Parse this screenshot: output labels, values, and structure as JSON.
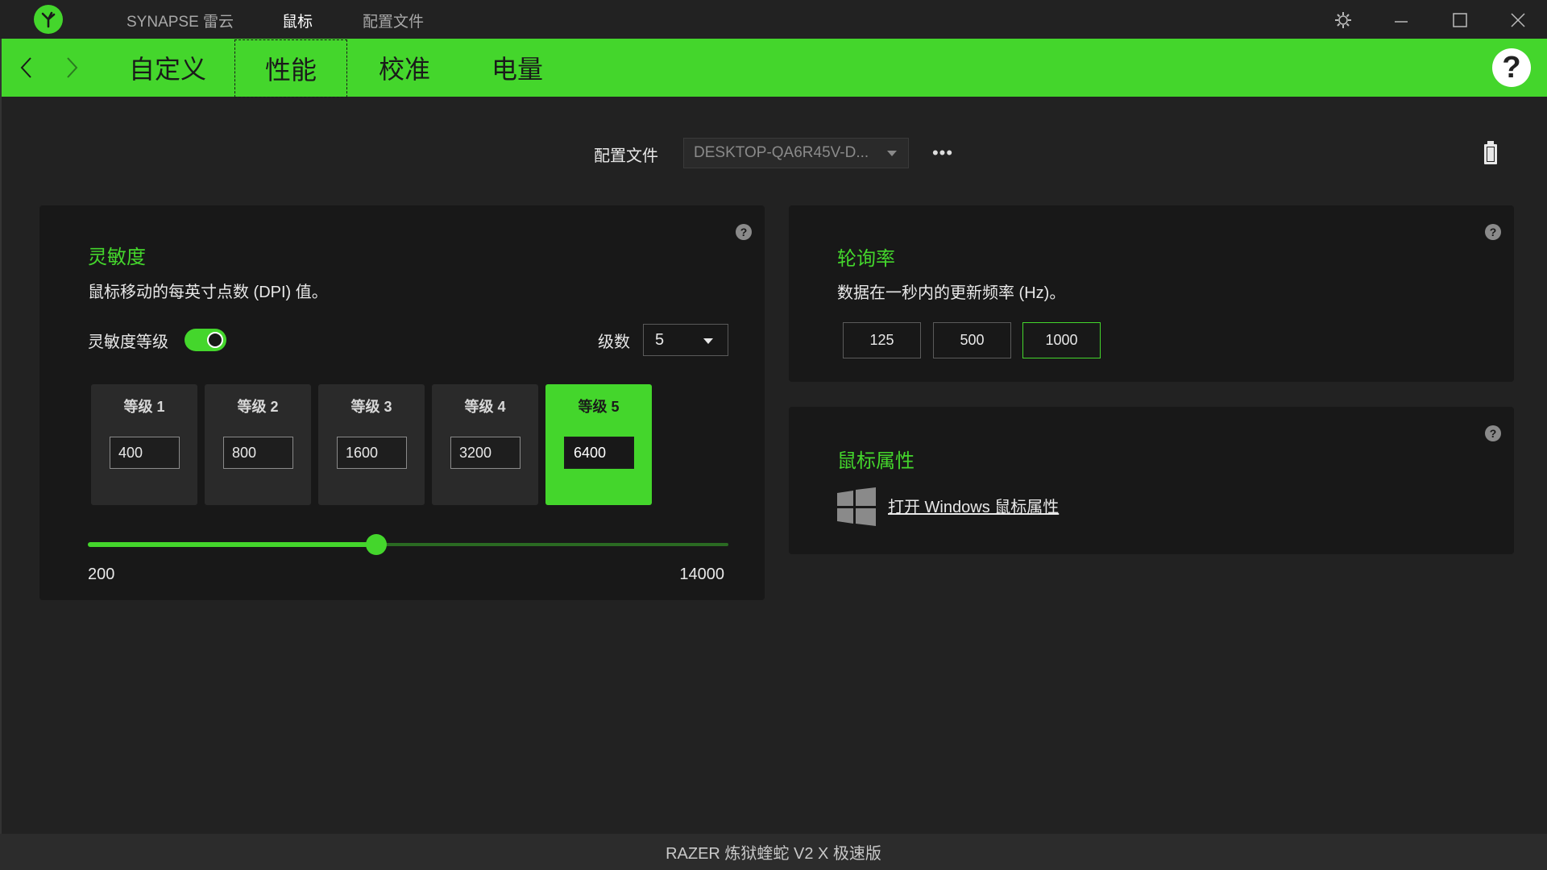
{
  "titlebar": {
    "nav": [
      "SYNAPSE 雷云",
      "鼠标",
      "配置文件"
    ],
    "active_nav": 1
  },
  "tabs": {
    "items": [
      "自定义",
      "性能",
      "校准",
      "电量"
    ],
    "active": 1
  },
  "profile": {
    "label": "配置文件",
    "value": "DESKTOP-QA6R45V-D...",
    "more": "•••"
  },
  "sensitivity": {
    "title": "灵敏度",
    "desc": "鼠标移动的每英寸点数 (DPI) 值。",
    "stages_toggle_label": "灵敏度等级",
    "stages_toggle_on": true,
    "levels_label": "级数",
    "levels_value": "5",
    "stages": [
      {
        "label": "等级 1",
        "value": "400"
      },
      {
        "label": "等级 2",
        "value": "800"
      },
      {
        "label": "等级 3",
        "value": "1600"
      },
      {
        "label": "等级 4",
        "value": "3200"
      },
      {
        "label": "等级 5",
        "value": "6400"
      }
    ],
    "active_stage": 4,
    "slider": {
      "min": "200",
      "max": "14000",
      "value": 6400
    }
  },
  "polling": {
    "title": "轮询率",
    "desc": "数据在一秒内的更新频率 (Hz)。",
    "options": [
      "125",
      "500",
      "1000"
    ],
    "active": 2
  },
  "mouse_props": {
    "title": "鼠标属性",
    "link": "打开 Windows 鼠标属性"
  },
  "status": {
    "device": "RAZER 炼狱蝰蛇 V2 X 极速版"
  },
  "colors": {
    "accent": "#44d62c",
    "background": "#222222",
    "panel": "#181818"
  }
}
